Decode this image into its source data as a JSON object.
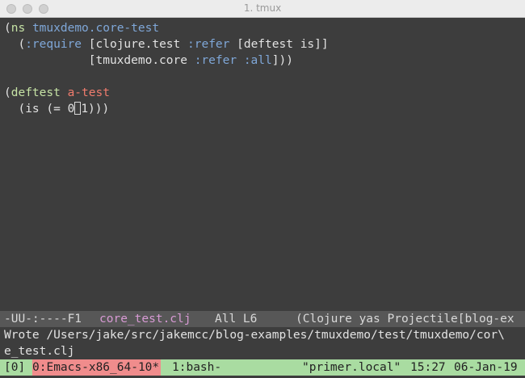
{
  "window": {
    "title": "1. tmux"
  },
  "editor": {
    "lines": [
      [
        "(",
        "ns",
        " ",
        "tmuxdemo.core-test"
      ],
      [
        "  (",
        ":require",
        " [clojure.test ",
        ":refer",
        " [deftest is]]"
      ],
      [
        "            [tmuxdemo.core ",
        ":refer",
        " ",
        ":all",
        "]))"
      ],
      [
        ""
      ],
      [
        "(",
        "deftest",
        " ",
        "a-test"
      ],
      [
        "  (is (= 0",
        "1)))"
      ]
    ]
  },
  "modeline": {
    "flags": "-UU-:----F1",
    "buffer": "core_test.clj",
    "position": "All L6",
    "modes": "(Clojure yas Projectile[blog-ex"
  },
  "echo_area": {
    "line1": "Wrote /Users/jake/src/jakemcc/blog-examples/tmuxdemo/test/tmuxdemo/cor\\",
    "line2": "e_test.clj"
  },
  "tmux_status": {
    "session": "[0]",
    "window0": "0:Emacs-x86_64-10*",
    "window1": "1:bash-",
    "host": "\"primer.local\"",
    "time": "15:27",
    "date": "06-Jan-19"
  }
}
